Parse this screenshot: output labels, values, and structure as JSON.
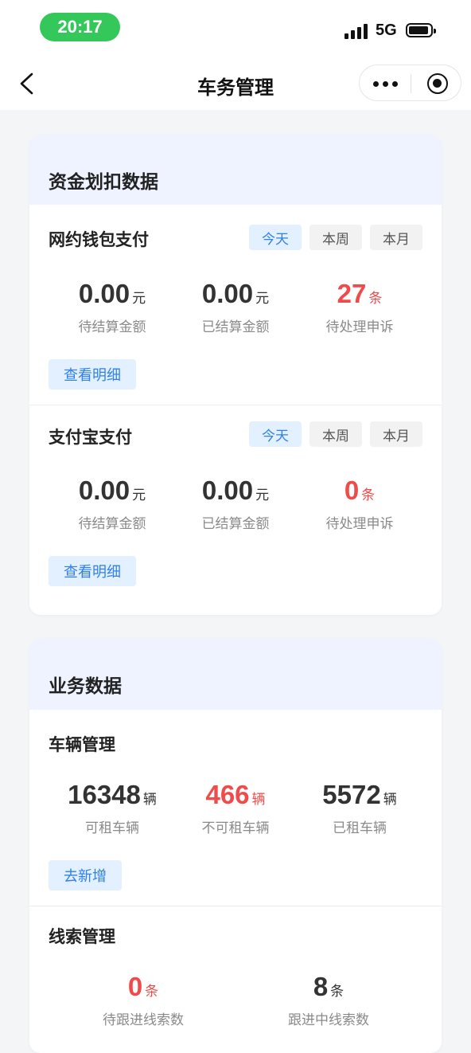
{
  "status": {
    "time": "20:17",
    "network": "5G"
  },
  "nav": {
    "title": "车务管理"
  },
  "fund_card": {
    "title": "资金划扣数据",
    "tabs": [
      "今天",
      "本周",
      "本月"
    ],
    "wallet": {
      "title": "网约钱包支付",
      "pending_amount": "0.00",
      "pending_unit": "元",
      "pending_label": "待结算金额",
      "settled_amount": "0.00",
      "settled_unit": "元",
      "settled_label": "已结算金额",
      "appeals": "27",
      "appeals_unit": "条",
      "appeals_label": "待处理申诉",
      "detail_button": "查看明细"
    },
    "alipay": {
      "title": "支付宝支付",
      "pending_amount": "0.00",
      "pending_unit": "元",
      "pending_label": "待结算金额",
      "settled_amount": "0.00",
      "settled_unit": "元",
      "settled_label": "已结算金额",
      "appeals": "0",
      "appeals_unit": "条",
      "appeals_label": "待处理申诉",
      "detail_button": "查看明细"
    }
  },
  "business_card": {
    "title": "业务数据",
    "vehicles": {
      "title": "车辆管理",
      "available": "16348",
      "available_unit": "辆",
      "available_label": "可租车辆",
      "unavailable": "466",
      "unavailable_unit": "辆",
      "unavailable_label": "不可租车辆",
      "rented": "5572",
      "rented_unit": "辆",
      "rented_label": "已租车辆",
      "add_button": "去新增"
    },
    "leads": {
      "title": "线索管理",
      "pending": "0",
      "pending_unit": "条",
      "pending_label": "待跟进线索数",
      "following": "8",
      "following_unit": "条",
      "following_label": "跟进中线索数"
    }
  },
  "colors": {
    "accent": "#2f80ed",
    "alert": "#f04b4b",
    "status_green": "#34c759"
  }
}
